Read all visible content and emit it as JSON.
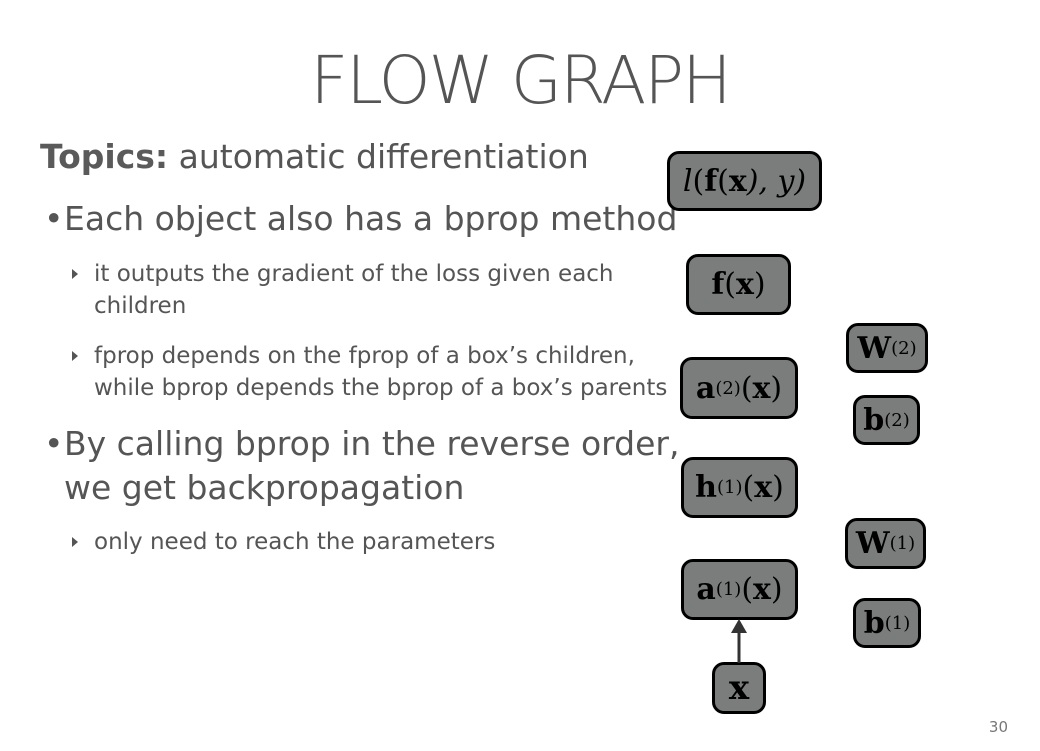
{
  "title": "FLOW GRAPH",
  "topics": {
    "label": "Topics:",
    "text": "automatic differentiation"
  },
  "bullets": [
    {
      "text": "Each object also has a bprop method",
      "subs": [
        {
          "lines": [
            "it outputs the gradient of the loss given each",
            "children"
          ]
        },
        {
          "lines": [
            "fprop depends on the fprop of a box’s children,",
            "while bprop depends the bprop of a box’s parents"
          ]
        }
      ]
    },
    {
      "lines": [
        "By calling bprop in the reverse order,",
        "we get backpropagation"
      ],
      "subs": [
        {
          "lines": [
            "only need to reach the parameters"
          ]
        }
      ]
    }
  ],
  "graph": {
    "node_fill": "#7a7d7c",
    "node_border": "#000000",
    "nodes": {
      "loss": {
        "base": "l",
        "open": "(",
        "f": "f",
        "x": "x",
        "rest": "), y)"
      },
      "fx": {
        "f": "f",
        "open": "(",
        "x": "x",
        "close": ")"
      },
      "a2": {
        "base": "a",
        "sup": "(2)",
        "open": "(",
        "x": "x",
        "close": ")"
      },
      "h1": {
        "base": "h",
        "sup": "(1)",
        "open": "(",
        "x": "x",
        "close": ")"
      },
      "a1": {
        "base": "a",
        "sup": "(1)",
        "open": "(",
        "x": "x",
        "close": ")"
      },
      "x": {
        "base": "x"
      },
      "W2": {
        "base": "W",
        "sup": "(2)"
      },
      "b2": {
        "base": "b",
        "sup": "(2)"
      },
      "W1": {
        "base": "W",
        "sup": "(1)"
      },
      "b1": {
        "base": "b",
        "sup": "(1)"
      }
    }
  },
  "page_number": "30"
}
